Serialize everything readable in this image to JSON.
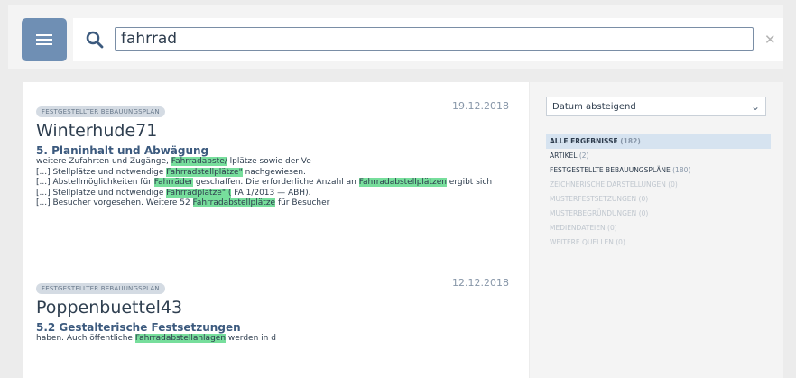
{
  "search": {
    "value": "fahrrad",
    "clear_label": "✕"
  },
  "results": [
    {
      "tag": "FESTGESTELLTER BEBAUUNGSPLAN",
      "date": "19.12.2018",
      "title": "Winterhude71",
      "section": "5. Planinhalt und Abwägung",
      "snippets": [
        [
          {
            "t": "weitere Zufahrten und Zugänge, "
          },
          {
            "t": "Fahrradabste/",
            "hl": true
          },
          {
            "t": " lplätze sowie der Ve"
          }
        ],
        [
          {
            "t": "[...] Stellplätze und notwendige "
          },
          {
            "t": "Fahrradstellplätze\"",
            "hl": true
          },
          {
            "t": " nachgewiesen."
          }
        ],
        [
          {
            "t": "[...] Abstellmöglichkeiten für "
          },
          {
            "t": "Fahrräder",
            "hl": true
          },
          {
            "t": " geschaffen. Die erforderliche Anzahl an "
          },
          {
            "t": "Fahrradabstellplätzen",
            "hl": true
          },
          {
            "t": " ergibt sich"
          }
        ],
        [
          {
            "t": "[...] Stellplätze und notwendige "
          },
          {
            "t": "Fahrradplätze\" (",
            "hl": true
          },
          {
            "t": " FA 1/2013 — ABH)."
          }
        ],
        [
          {
            "t": "[...] Besucher vorgesehen. Weitere 52 "
          },
          {
            "t": "Fahrradabstellplätze",
            "hl": true
          },
          {
            "t": " für Besucher"
          }
        ]
      ]
    },
    {
      "tag": "FESTGESTELLTER BEBAUUNGSPLAN",
      "date": "12.12.2018",
      "title": "Poppenbuettel43",
      "section": "5.2 Gestalterische Festsetzungen",
      "snippets": [
        [
          {
            "t": "haben. Auch öffentliche "
          },
          {
            "t": "Fahrradabstellanlagen",
            "hl": true
          },
          {
            "t": " werden in d"
          }
        ]
      ]
    }
  ],
  "sort": {
    "selected": "Datum absteigend"
  },
  "filters": [
    {
      "label": "ALLE ERGEBNISSE",
      "count": "(182)",
      "state": "active"
    },
    {
      "label": "ARTIKEL",
      "count": "(2)",
      "state": "normal"
    },
    {
      "label": "FESTGESTELLTE BEBAUUNGSPLÄNE",
      "count": "(180)",
      "state": "normal"
    },
    {
      "label": "ZEICHNERISCHE DARSTELLUNGEN",
      "count": "(0)",
      "state": "disabled"
    },
    {
      "label": "MUSTERFESTSETZUNGEN",
      "count": "(0)",
      "state": "disabled"
    },
    {
      "label": "MUSTERBEGRÜNDUNGEN",
      "count": "(0)",
      "state": "disabled"
    },
    {
      "label": "MEDIENDATEIEN",
      "count": "(0)",
      "state": "disabled"
    },
    {
      "label": "WEITERE QUELLEN",
      "count": "(0)",
      "state": "disabled"
    }
  ],
  "colors": {
    "accent": "#6f8fb4",
    "highlight": "#77de9c",
    "heading": "#3c5a7e"
  },
  "icons": {
    "menu": "menu-icon",
    "search": "search-icon",
    "clear": "close-icon",
    "dropdown": "chevron-down-icon"
  }
}
